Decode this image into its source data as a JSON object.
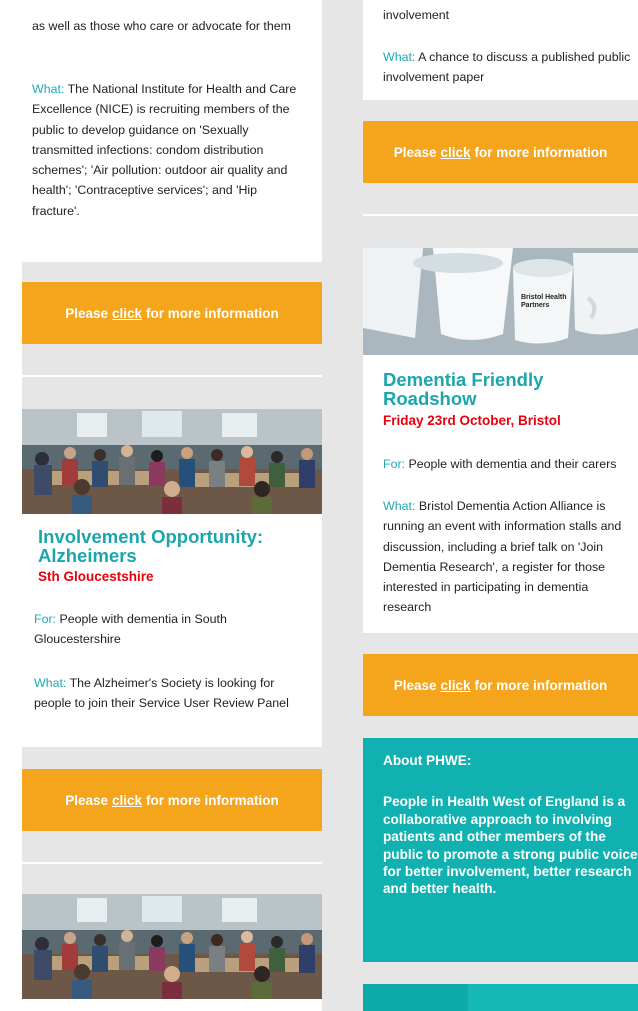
{
  "left": {
    "card1": {
      "text_top": "as well as those who care or advocate for them",
      "what_label": "What:",
      "what_text": "The National Institute for Health and Care Excellence (NICE) is recruiting members of the public to develop guidance on 'Sexually transmitted infections: condom distribution schemes'; 'Air pollution: outdoor air quality and health'; 'Contraceptive services'; and 'Hip fracture'."
    },
    "cta1": {
      "pre": "Please ",
      "link": "click",
      "post": " for more information"
    },
    "card2": {
      "title": "Involvement Opportunity: Alzheimers",
      "subtitle": "Sth Gloucestshire",
      "for_label": "For:",
      "for_text": "People with dementia in South Gloucestershire",
      "what_label": "What:",
      "what_text": "The Alzheimer's Society is looking for people to join their Service User Review Panel"
    },
    "cta2": {
      "pre": "Please ",
      "link": "click",
      "post": " for more information"
    }
  },
  "right": {
    "card1": {
      "text_top": "involvement",
      "what_label": "What:",
      "what_text": "A chance to discuss a published public involvement paper"
    },
    "cta1": {
      "pre": "Please ",
      "link": "click",
      "post": " for more information"
    },
    "card2": {
      "mug_text": "Bristol Health Partners",
      "title": "Dementia Friendly Roadshow",
      "subtitle": "Friday 23rd October, Bristol",
      "for_label": "For:",
      "for_text": "People with dementia and their carers",
      "what_label": "What:",
      "what_text": "Bristol Dementia Action Alliance is running an event with information stalls and discussion, including a brief talk on 'Join Dementia Research', a register for those interested in participating in dementia research"
    },
    "cta2": {
      "pre": "Please ",
      "link": "click",
      "post": " for more information"
    },
    "about": {
      "heading": "About PHWE:",
      "body": "People in Health West of England is a collaborative approach to involving patients and other members of the public to promote a strong public voice for better involvement, better research and better health."
    }
  },
  "colors": {
    "accent_orange": "#f4a51c",
    "teal": "#10b1b0",
    "title_teal": "#1aa6ac",
    "subtitle_red": "#e8000e",
    "background": "#e6e6e6"
  }
}
